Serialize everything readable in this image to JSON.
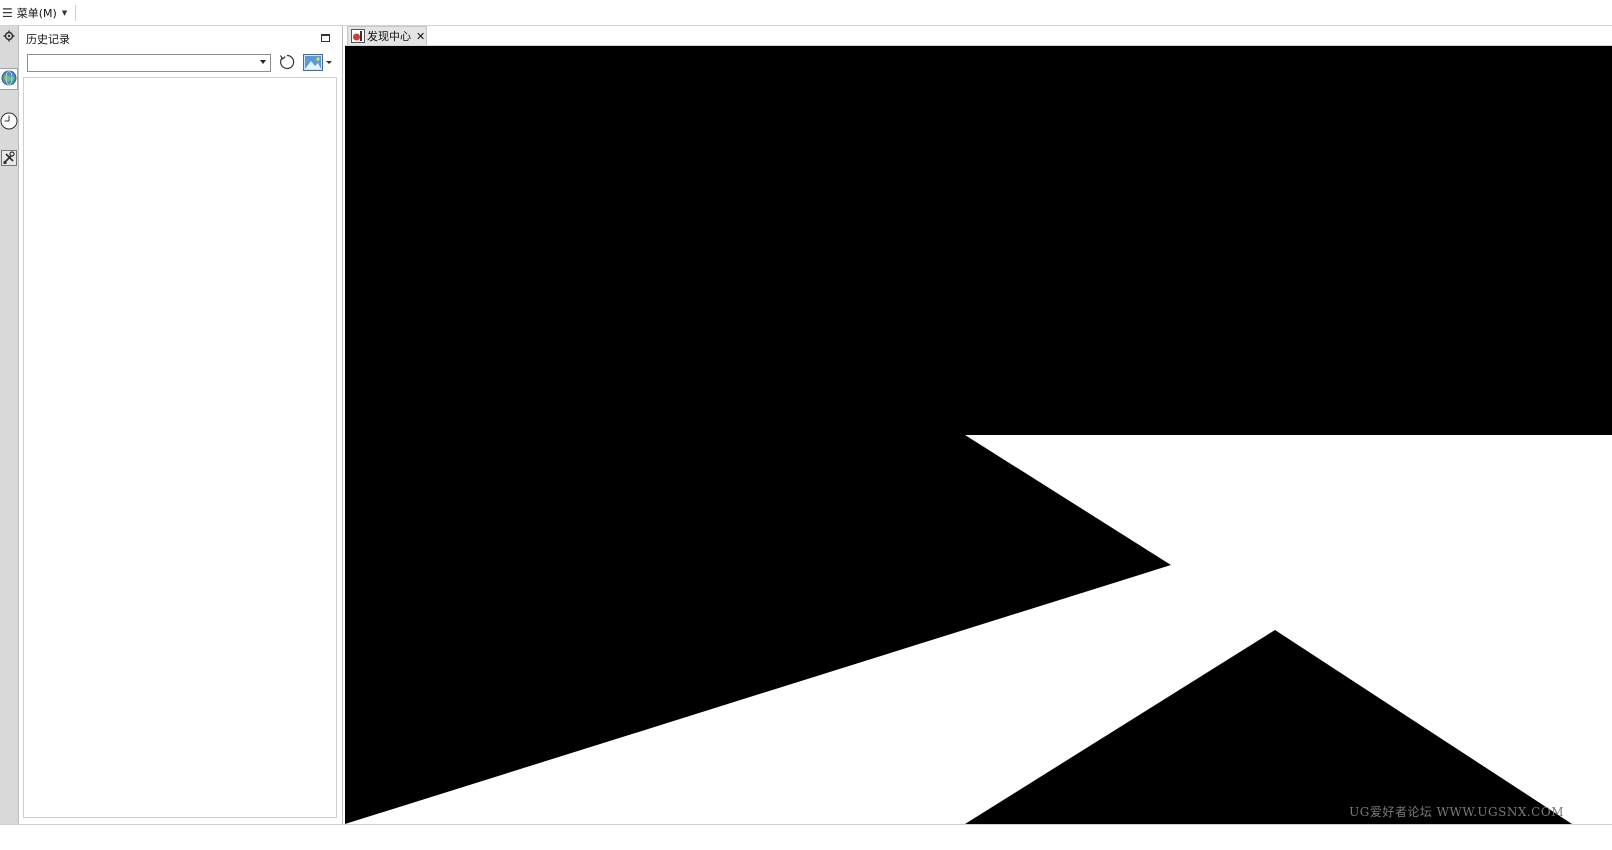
{
  "menubar": {
    "menu_label": "菜单(M)",
    "menu_icon": "hamburger-icon"
  },
  "resource_bar": {
    "items": [
      {
        "icon": "settings-gear-icon"
      },
      {
        "icon": "web-globe-icon",
        "active": true
      },
      {
        "icon": "history-clock-icon"
      },
      {
        "icon": "tools-icon"
      }
    ]
  },
  "history_panel": {
    "title": "历史记录",
    "filter_value": "",
    "icons": [
      "maximize-icon",
      "refresh-icon",
      "image-view-icon"
    ]
  },
  "tabs": [
    {
      "label": "发现中心",
      "icon": "discovery-icon",
      "closable": true
    }
  ],
  "viewport": {
    "watermark": "UG爱好者论坛 WWW.UGSNX.COM",
    "background": "#ffffff",
    "fill": "#000000"
  }
}
